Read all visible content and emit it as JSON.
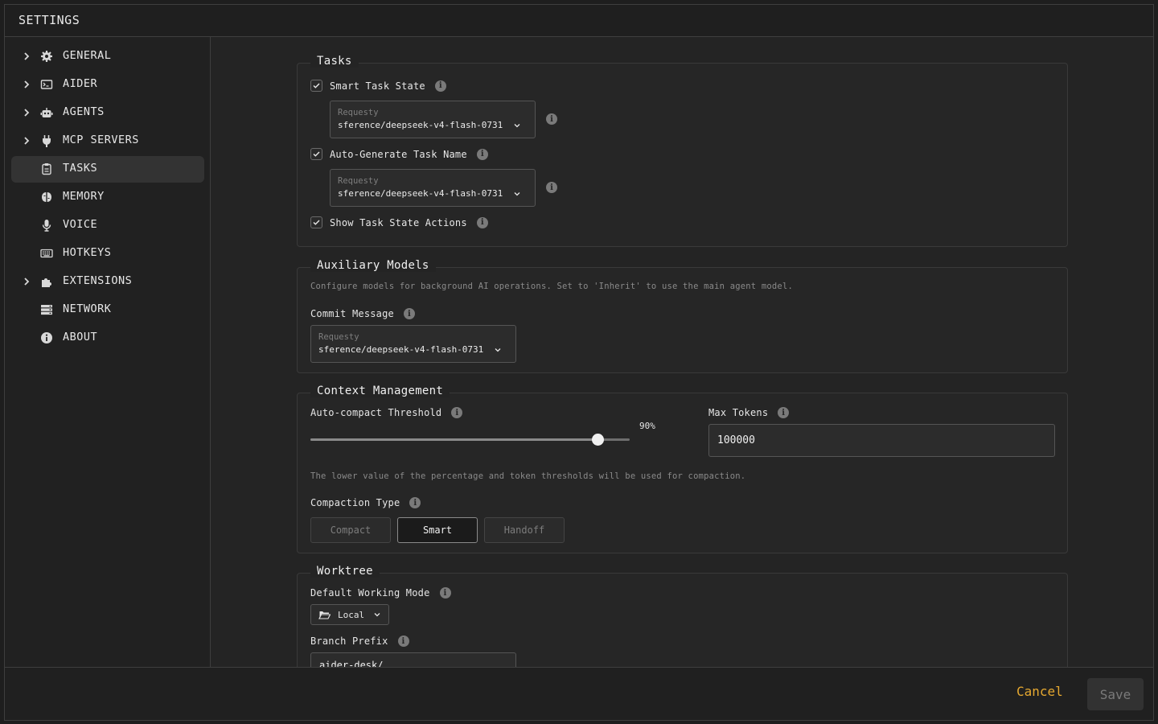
{
  "window": {
    "title": "SETTINGS"
  },
  "sidebar": {
    "items": [
      {
        "label": "GENERAL",
        "icon": "gear-icon",
        "expandable": true,
        "active": false
      },
      {
        "label": "AIDER",
        "icon": "terminal-icon",
        "expandable": true,
        "active": false
      },
      {
        "label": "AGENTS",
        "icon": "robot-icon",
        "expandable": true,
        "active": false
      },
      {
        "label": "MCP SERVERS",
        "icon": "plug-icon",
        "expandable": true,
        "active": false
      },
      {
        "label": "TASKS",
        "icon": "clipboard-icon",
        "expandable": false,
        "active": true
      },
      {
        "label": "MEMORY",
        "icon": "brain-icon",
        "expandable": false,
        "active": false
      },
      {
        "label": "VOICE",
        "icon": "microphone-icon",
        "expandable": false,
        "active": false
      },
      {
        "label": "HOTKEYS",
        "icon": "keyboard-icon",
        "expandable": false,
        "active": false
      },
      {
        "label": "EXTENSIONS",
        "icon": "puzzle-icon",
        "expandable": true,
        "active": false
      },
      {
        "label": "NETWORK",
        "icon": "server-icon",
        "expandable": false,
        "active": false
      },
      {
        "label": "ABOUT",
        "icon": "info-icon",
        "expandable": false,
        "active": false
      }
    ]
  },
  "tasks": {
    "legend": "Tasks",
    "smart_task_state": {
      "label": "Smart Task State",
      "checked": true
    },
    "smart_task_model": {
      "provider": "Requesty",
      "value": "sference/deepseek-v4-flash-0731"
    },
    "auto_generate": {
      "label": "Auto-Generate Task Name",
      "checked": true
    },
    "auto_generate_model": {
      "provider": "Requesty",
      "value": "sference/deepseek-v4-flash-0731"
    },
    "show_actions": {
      "label": "Show Task State Actions",
      "checked": true
    }
  },
  "auxiliary": {
    "legend": "Auxiliary Models",
    "description": "Configure models for background AI operations. Set to 'Inherit' to use the main agent model.",
    "commit_label": "Commit Message",
    "commit_model": {
      "provider": "Requesty",
      "value": "sference/deepseek-v4-flash-0731"
    }
  },
  "context": {
    "legend": "Context Management",
    "threshold_label": "Auto-compact Threshold",
    "threshold_value": 90,
    "threshold_display": "90%",
    "max_tokens_label": "Max Tokens",
    "max_tokens_value": "100000",
    "note": "The lower value of the percentage and token thresholds will be used for compaction.",
    "compaction_label": "Compaction Type",
    "compaction_options": [
      "Compact",
      "Smart",
      "Handoff"
    ],
    "compaction_selected": "Smart"
  },
  "worktree": {
    "legend": "Worktree",
    "mode_label": "Default Working Mode",
    "mode_value": "Local",
    "branch_label": "Branch Prefix",
    "branch_value": "aider-desk/"
  },
  "footer": {
    "cancel": "Cancel",
    "save": "Save"
  },
  "colors": {
    "accent": "#e5a830",
    "background": "#242424",
    "sidebar_active": "#333333"
  }
}
